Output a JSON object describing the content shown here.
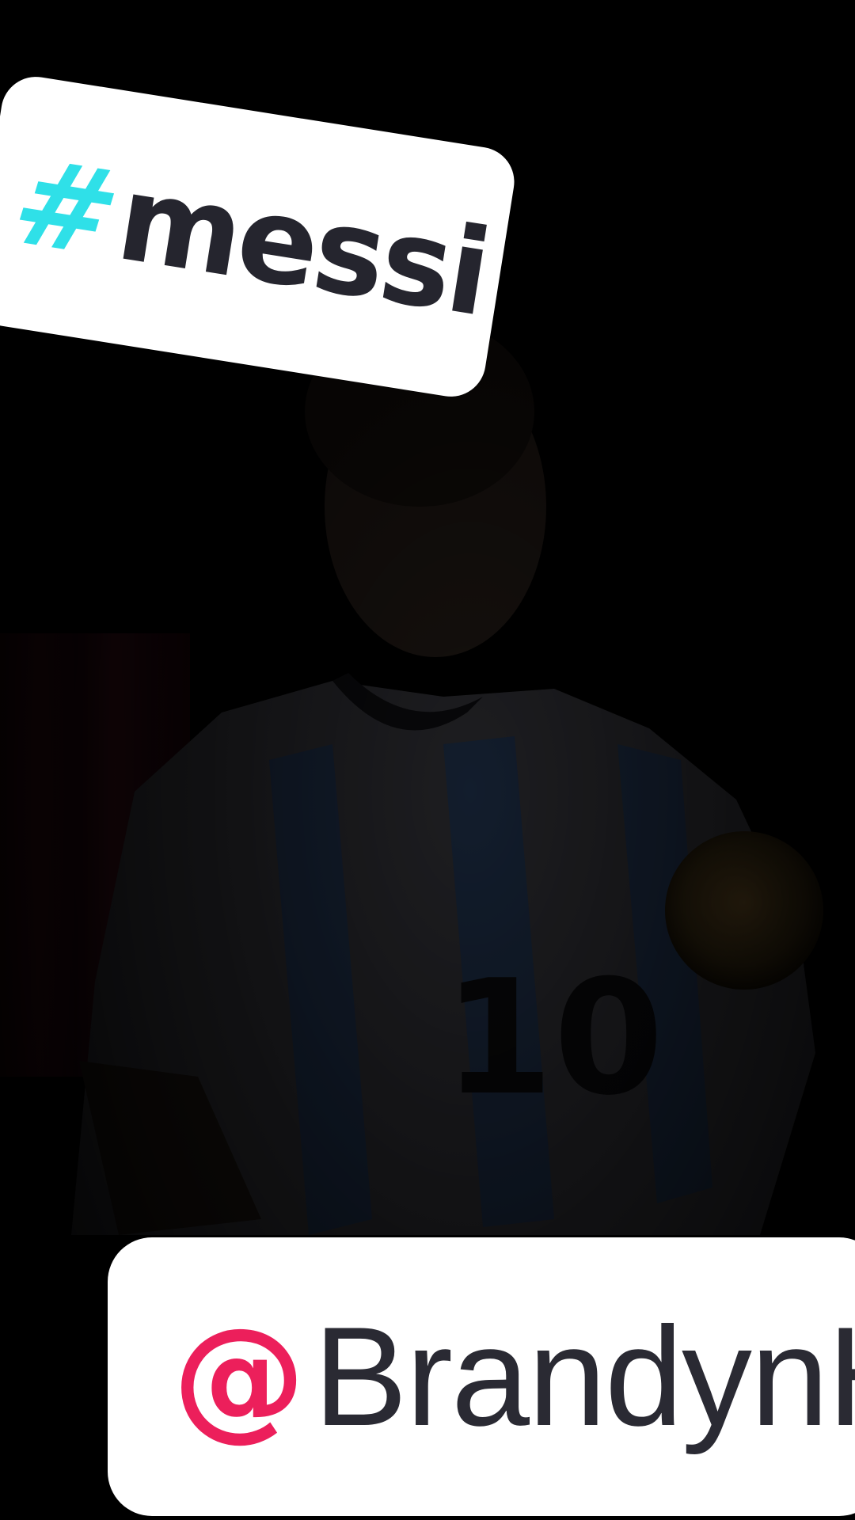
{
  "hashtag": {
    "symbol": "#",
    "text": "messi"
  },
  "mention": {
    "symbol": "@",
    "text": "BrandynH"
  },
  "colors": {
    "background": "#000000",
    "hash_accent": "#2fe0e8",
    "at_accent": "#ec1f5b",
    "sticker_bg": "#ffffff",
    "sticker_text": "#25252e"
  }
}
